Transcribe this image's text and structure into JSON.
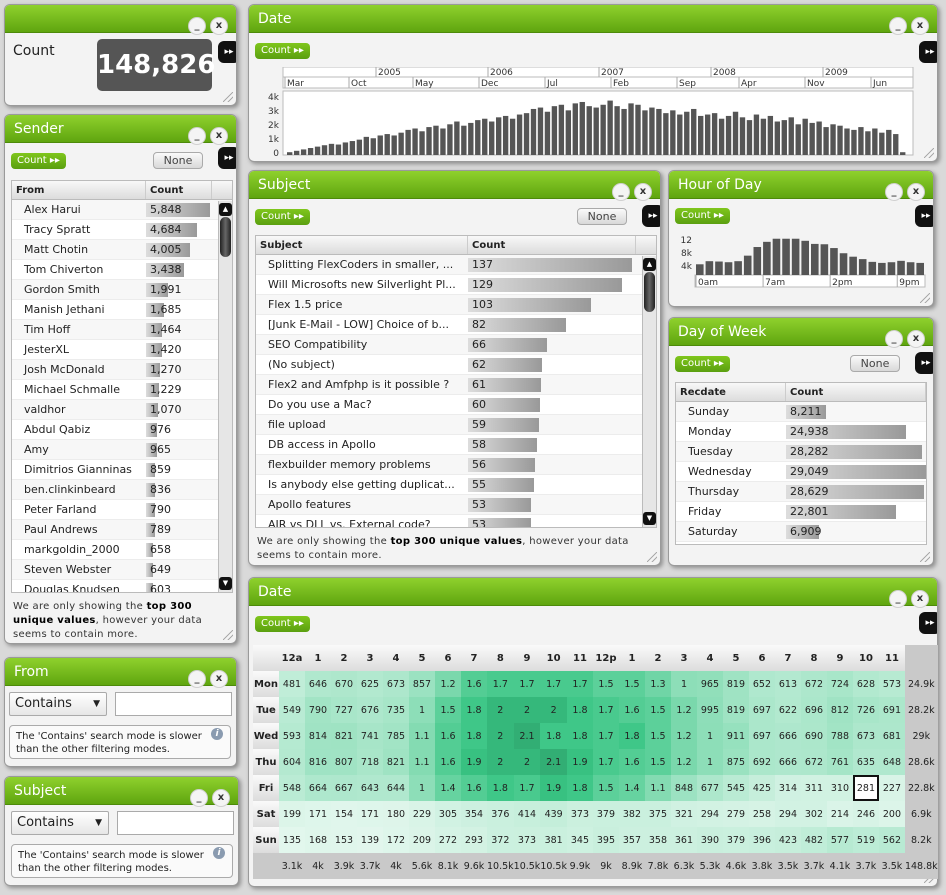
{
  "count_panel": {
    "title": "Count",
    "value": "148,826"
  },
  "date_panel": {
    "title": "Date",
    "count_btn": "Count ▸▸",
    "years": [
      "2005",
      "2006",
      "2007",
      "2008",
      "2009"
    ],
    "months": [
      "Mar",
      "Oct",
      "May",
      "Dec",
      "Jul",
      "Feb",
      "Sep",
      "Apr",
      "Nov",
      "Jun"
    ],
    "yticks": [
      "4k",
      "3k",
      "2k",
      "1k",
      "0"
    ]
  },
  "sender_panel": {
    "title": "Sender",
    "count_btn": "Count ▸▸",
    "none_btn": "None",
    "col_from": "From",
    "col_count": "Count",
    "rows": [
      {
        "name": "Alex Harui",
        "count": "5,848",
        "v": 5848
      },
      {
        "name": "Tracy Spratt",
        "count": "4,684",
        "v": 4684
      },
      {
        "name": "Matt Chotin",
        "count": "4,005",
        "v": 4005
      },
      {
        "name": "Tom Chiverton",
        "count": "3,438",
        "v": 3438
      },
      {
        "name": "Gordon Smith",
        "count": "1,991",
        "v": 1991
      },
      {
        "name": "Manish Jethani",
        "count": "1,685",
        "v": 1685
      },
      {
        "name": "Tim Hoff",
        "count": "1,464",
        "v": 1464
      },
      {
        "name": "JesterXL",
        "count": "1,420",
        "v": 1420
      },
      {
        "name": "Josh McDonald",
        "count": "1,270",
        "v": 1270
      },
      {
        "name": "Michael Schmalle",
        "count": "1,229",
        "v": 1229
      },
      {
        "name": "valdhor",
        "count": "1,070",
        "v": 1070
      },
      {
        "name": "Abdul Qabiz",
        "count": "976",
        "v": 976
      },
      {
        "name": "Amy",
        "count": "965",
        "v": 965
      },
      {
        "name": "Dimitrios Gianninas",
        "count": "859",
        "v": 859
      },
      {
        "name": "ben.clinkinbeard",
        "count": "836",
        "v": 836
      },
      {
        "name": "Peter Farland",
        "count": "790",
        "v": 790
      },
      {
        "name": "Paul Andrews",
        "count": "789",
        "v": 789
      },
      {
        "name": "markgoldin_2000",
        "count": "658",
        "v": 658
      },
      {
        "name": "Steven Webster",
        "count": "649",
        "v": 649
      },
      {
        "name": "Douglas Knudsen",
        "count": "603",
        "v": 603
      }
    ],
    "note_pre": "We are only showing the ",
    "note_bold": "top 300 unique values",
    "note_post": ", however your data seems to contain more."
  },
  "subject_panel": {
    "title": "Subject",
    "count_btn": "Count ▸▸",
    "none_btn": "None",
    "col_subject": "Subject",
    "col_count": "Count",
    "rows": [
      {
        "name": "Splitting FlexCoders in smaller, ...",
        "count": "137",
        "v": 137
      },
      {
        "name": "Will Microsofts new Silverlight Pl...",
        "count": "129",
        "v": 129
      },
      {
        "name": "Flex 1.5 price",
        "count": "103",
        "v": 103
      },
      {
        "name": "[Junk E-Mail - LOW] Choice of b...",
        "count": "82",
        "v": 82
      },
      {
        "name": "SEO Compatibility",
        "count": "66",
        "v": 66
      },
      {
        "name": "(No subject)",
        "count": "62",
        "v": 62
      },
      {
        "name": "Flex2 and Amfphp is it possible ?",
        "count": "61",
        "v": 61
      },
      {
        "name": "Do you use a Mac?",
        "count": "60",
        "v": 60
      },
      {
        "name": "file upload",
        "count": "59",
        "v": 59
      },
      {
        "name": "DB access in Apollo",
        "count": "58",
        "v": 58
      },
      {
        "name": "flexbuilder memory problems",
        "count": "56",
        "v": 56
      },
      {
        "name": "Is anybody else getting duplicat...",
        "count": "55",
        "v": 55
      },
      {
        "name": "Apollo features",
        "count": "53",
        "v": 53
      },
      {
        "name": "AIR vs DLL vs. External code?",
        "count": "53",
        "v": 53
      }
    ],
    "note_pre": "We are only showing the ",
    "note_bold": "top 300 unique values",
    "note_post": ", however your data seems to contain more."
  },
  "hour_panel": {
    "title": "Hour of Day",
    "count_btn": "Count ▸▸",
    "yticks": [
      "12",
      "8k",
      "4k"
    ],
    "xticks": [
      "0am",
      "7am",
      "2pm",
      "9pm"
    ]
  },
  "dow_panel": {
    "title": "Day of Week",
    "count_btn": "Count ▸▸",
    "none_btn": "None",
    "col_day": "Recdate",
    "col_count": "Count",
    "rows": [
      {
        "name": "Sunday",
        "count": "8,211",
        "v": 8211
      },
      {
        "name": "Monday",
        "count": "24,938",
        "v": 24938
      },
      {
        "name": "Tuesday",
        "count": "28,282",
        "v": 28282
      },
      {
        "name": "Wednesday",
        "count": "29,049",
        "v": 29049
      },
      {
        "name": "Thursday",
        "count": "28,629",
        "v": 28629
      },
      {
        "name": "Friday",
        "count": "22,801",
        "v": 22801
      },
      {
        "name": "Saturday",
        "count": "6,909",
        "v": 6909
      }
    ]
  },
  "from_filter": {
    "title": "From",
    "mode": "Contains",
    "hint": "The 'Contains' search mode is slower than the other filtering modes."
  },
  "subject_filter": {
    "title": "Subject",
    "mode": "Contains",
    "hint": "The 'Contains' search mode is slower than the other filtering modes."
  },
  "heatmap_panel": {
    "title": "Date",
    "count_btn": "Count ▸▸",
    "hours": [
      "12a",
      "1",
      "2",
      "3",
      "4",
      "5",
      "6",
      "7",
      "8",
      "9",
      "10",
      "11",
      "12p",
      "1",
      "2",
      "3",
      "4",
      "5",
      "6",
      "7",
      "8",
      "9",
      "10",
      "11"
    ],
    "days": [
      "Mon",
      "Tue",
      "Wed",
      "Thu",
      "Fri",
      "Sat",
      "Sun"
    ],
    "cells": [
      [
        "481",
        "646",
        "670",
        "625",
        "673",
        "857",
        "1.2",
        "1.6",
        "1.7",
        "1.7",
        "1.7",
        "1.7",
        "1.5",
        "1.5",
        "1.3",
        "1",
        "965",
        "819",
        "652",
        "613",
        "672",
        "724",
        "628",
        "573",
        "24.9k"
      ],
      [
        "549",
        "790",
        "727",
        "676",
        "735",
        "1",
        "1.5",
        "1.8",
        "2",
        "2",
        "2",
        "1.8",
        "1.7",
        "1.6",
        "1.5",
        "1.2",
        "995",
        "819",
        "697",
        "622",
        "696",
        "812",
        "726",
        "691",
        "28.2k"
      ],
      [
        "593",
        "814",
        "821",
        "741",
        "785",
        "1.1",
        "1.6",
        "1.8",
        "2",
        "2.1",
        "1.8",
        "1.8",
        "1.7",
        "1.8",
        "1.5",
        "1.2",
        "1",
        "911",
        "697",
        "666",
        "690",
        "788",
        "673",
        "681",
        "29k"
      ],
      [
        "604",
        "816",
        "807",
        "718",
        "821",
        "1.1",
        "1.6",
        "1.9",
        "2",
        "2",
        "2.1",
        "1.9",
        "1.7",
        "1.6",
        "1.5",
        "1.2",
        "1",
        "875",
        "692",
        "666",
        "672",
        "761",
        "635",
        "648",
        "28.6k"
      ],
      [
        "548",
        "664",
        "667",
        "643",
        "644",
        "1",
        "1.4",
        "1.6",
        "1.8",
        "1.7",
        "1.9",
        "1.8",
        "1.5",
        "1.4",
        "1.1",
        "848",
        "677",
        "545",
        "425",
        "314",
        "311",
        "310",
        "281",
        "227",
        "22.8k"
      ],
      [
        "199",
        "171",
        "154",
        "171",
        "180",
        "229",
        "305",
        "354",
        "376",
        "414",
        "439",
        "373",
        "379",
        "382",
        "375",
        "321",
        "294",
        "279",
        "258",
        "294",
        "302",
        "214",
        "246",
        "200",
        "6.9k"
      ],
      [
        "135",
        "168",
        "153",
        "139",
        "172",
        "209",
        "272",
        "293",
        "372",
        "373",
        "381",
        "345",
        "395",
        "357",
        "358",
        "361",
        "390",
        "379",
        "396",
        "423",
        "482",
        "577",
        "519",
        "562",
        "8.2k"
      ]
    ],
    "totals": [
      "3.1k",
      "4k",
      "3.9k",
      "3.7k",
      "4k",
      "5.6k",
      "8.1k",
      "9.6k",
      "10.5k",
      "10.5k",
      "10.5k",
      "9.9k",
      "9k",
      "8.9k",
      "7.8k",
      "6.3k",
      "5.3k",
      "4.6k",
      "3.8k",
      "3.5k",
      "3.7k",
      "4.1k",
      "3.7k",
      "3.5k",
      "148.8k"
    ]
  },
  "colors": {
    "accent": "#6cb31a",
    "dark": "#111111"
  }
}
